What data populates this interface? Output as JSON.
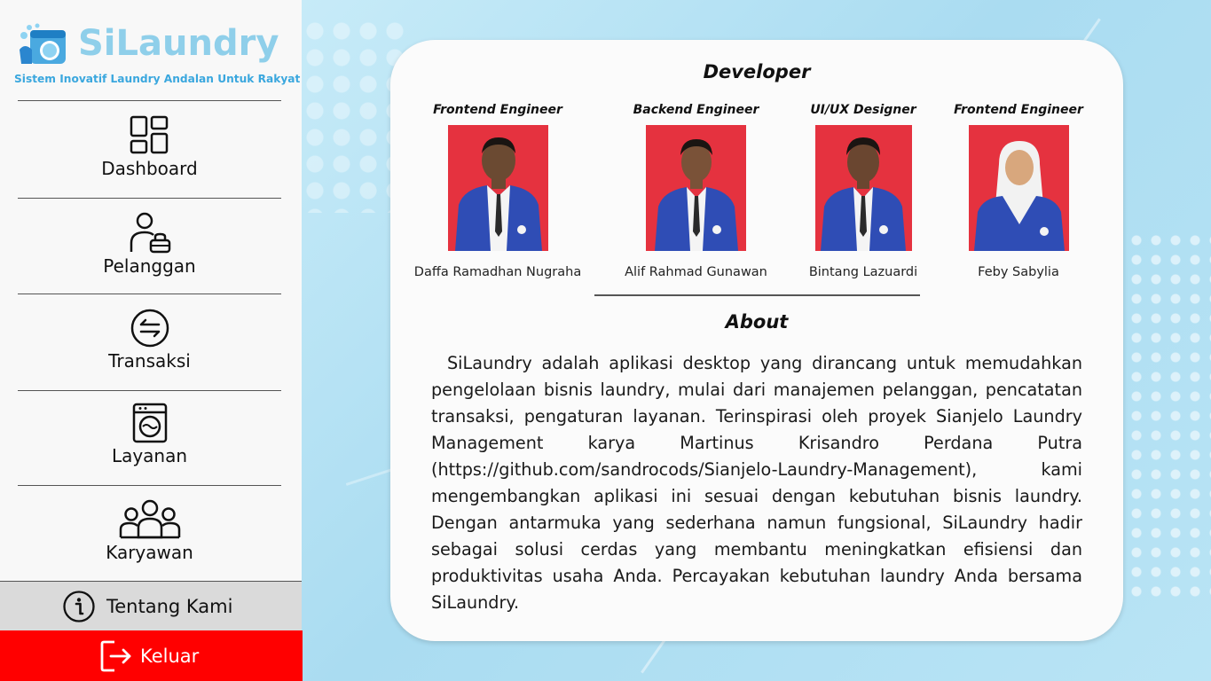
{
  "app": {
    "name": "SiLaundry",
    "tagline": "Sistem Inovatif Laundry Andalan Untuk Rakyat"
  },
  "sidebar": {
    "items": [
      {
        "label": "Dashboard",
        "icon": "dashboard-grid-icon"
      },
      {
        "label": "Pelanggan",
        "icon": "customer-icon"
      },
      {
        "label": "Transaksi",
        "icon": "transaction-icon"
      },
      {
        "label": "Layanan",
        "icon": "washing-machine-icon"
      },
      {
        "label": "Karyawan",
        "icon": "employees-icon"
      }
    ],
    "about": {
      "label": "Tentang Kami",
      "icon": "info-icon"
    },
    "logout": {
      "label": "Keluar",
      "icon": "logout-icon"
    }
  },
  "developer": {
    "title": "Developer",
    "members": [
      {
        "role": "Frontend Engineer",
        "name": "Daffa Ramadhan Nugraha",
        "photo": "member-photo"
      },
      {
        "role": "Backend Engineer",
        "name": "Alif Rahmad Gunawan",
        "photo": "member-photo"
      },
      {
        "role": "UI/UX Designer",
        "name": "Bintang Lazuardi",
        "photo": "member-photo"
      },
      {
        "role": "Frontend Engineer",
        "name": "Feby Sabylia",
        "photo": "member-photo"
      }
    ]
  },
  "about": {
    "title": "About",
    "text": "SiLaundry adalah aplikasi desktop yang dirancang untuk memudahkan pengelolaan bisnis laundry, mulai dari manajemen pelanggan, pencatatan transaksi, pengaturan layanan. Terinspirasi oleh proyek Sianjelo Laundry Management karya Martinus Krisandro Perdana Putra (https://github.com/sandrocods/Sianjelo-Laundry-Management),  kami mengembangkan aplikasi ini sesuai dengan kebutuhan bisnis laundry. Dengan antarmuka yang sederhana namun fungsional, SiLaundry hadir sebagai solusi cerdas yang membantu meningkatkan efisiensi dan produktivitas usaha Anda. Percayakan kebutuhan laundry Anda bersama SiLaundry."
  },
  "colors": {
    "brand": "#8fcfea",
    "tagline": "#3aa7de",
    "active_nav": "#dadada",
    "logout": "#ff0000",
    "photo_bg": "#e5323f",
    "blazer": "#2f4db5"
  }
}
